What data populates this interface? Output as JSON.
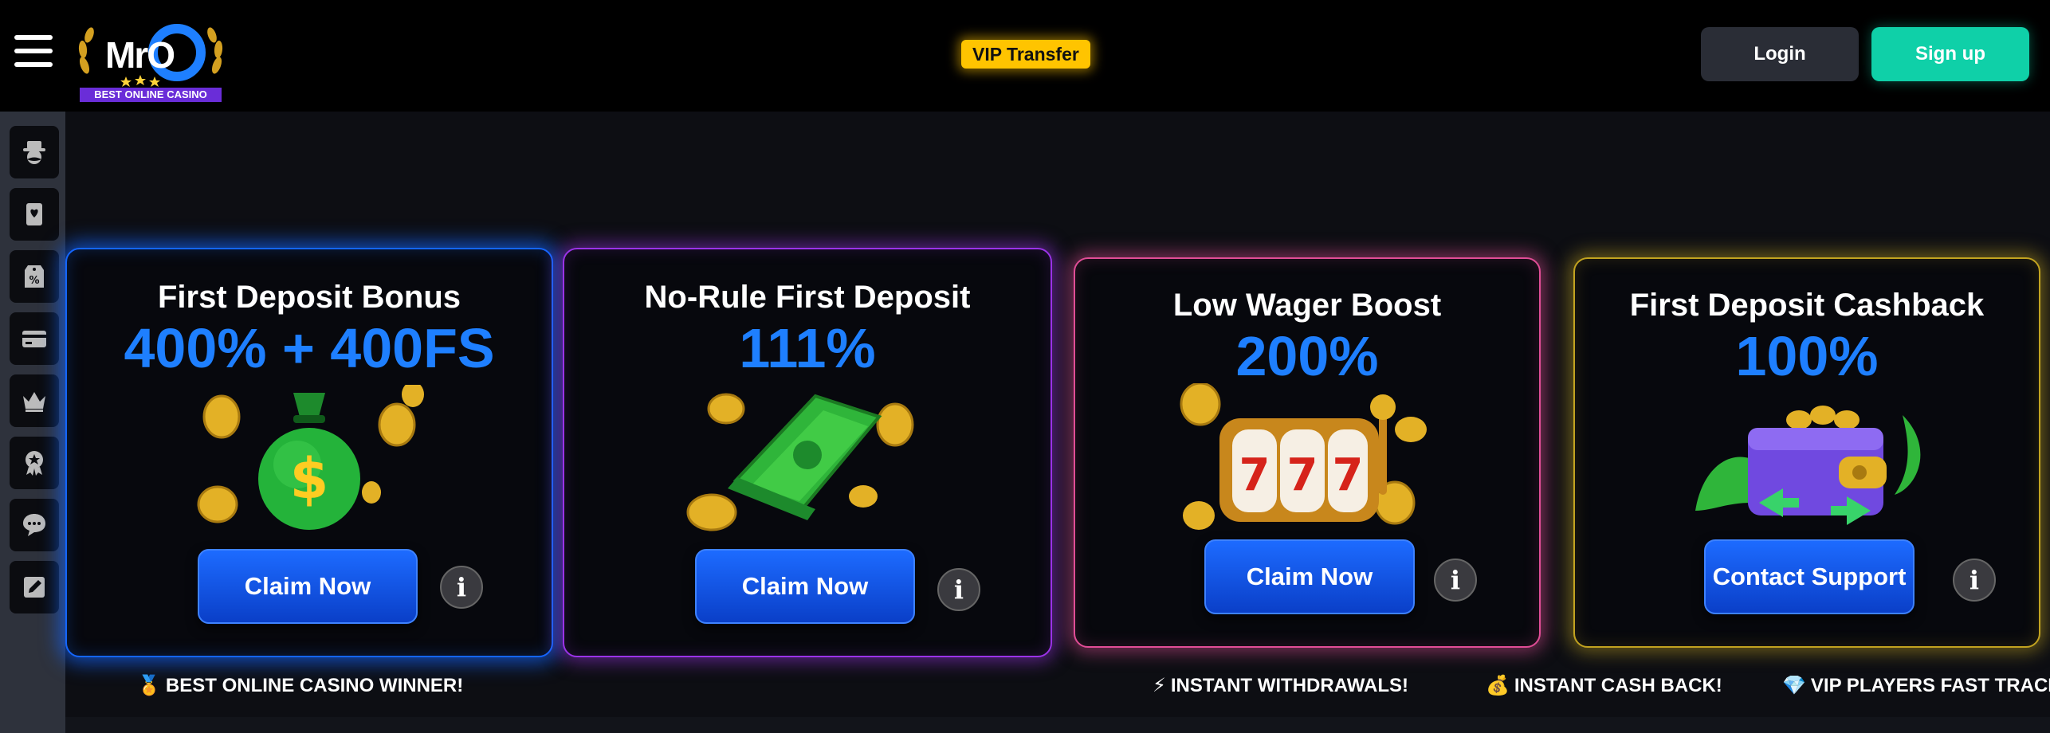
{
  "header": {
    "menu_icon": "hamburger-icon",
    "logo": {
      "wordmark": "MrO",
      "tagline": "BEST ONLINE CASINO"
    },
    "vip_badge": "VIP Transfer",
    "login_label": "Login",
    "signup_label": "Sign up",
    "colors": {
      "vip": "#ffc400",
      "signup": "#0fd0a8",
      "login": "#2a2d36"
    }
  },
  "sidebar": {
    "items": [
      {
        "icon": "mr-o-mascot-icon"
      },
      {
        "icon": "playing-card-icon"
      },
      {
        "icon": "percent-tag-icon"
      },
      {
        "icon": "credit-card-icon"
      },
      {
        "icon": "crown-icon"
      },
      {
        "icon": "award-badge-icon"
      },
      {
        "icon": "support-chat-icon"
      },
      {
        "icon": "edit-document-icon"
      }
    ]
  },
  "promotions": [
    {
      "title": "First Deposit Bonus",
      "amount": "400% + 400FS",
      "button": "Claim Now",
      "info": "i",
      "image": "money-bag-icon",
      "accent": "#1466ff"
    },
    {
      "title": "No-Rule First Deposit",
      "amount": "111%",
      "button": "Claim Now",
      "info": "i",
      "image": "cash-stack-icon",
      "accent": "#9b33e8"
    },
    {
      "title": "Low Wager Boost",
      "amount": "200%",
      "button": "Claim Now",
      "info": "i",
      "image": "slot-machine-icon",
      "accent": "#e04d96"
    },
    {
      "title": "First Deposit Cashback",
      "amount": "100%",
      "button": "Contact Support",
      "info": "i",
      "image": "wallet-cashback-icon",
      "accent": "#c2a320"
    }
  ],
  "ticker": [
    {
      "icon": "medal-icon",
      "glyph": "🏅",
      "text": "BEST ONLINE CASINO WINNER!"
    },
    {
      "icon": "lightning-icon",
      "glyph": "⚡",
      "text": "INSTANT WITHDRAWALS!"
    },
    {
      "icon": "money-bag-icon",
      "glyph": "💰",
      "text": "INSTANT CASH BACK!"
    },
    {
      "icon": "diamond-icon",
      "glyph": "💎",
      "text": "VIP PLAYERS FAST TRACK!"
    }
  ]
}
